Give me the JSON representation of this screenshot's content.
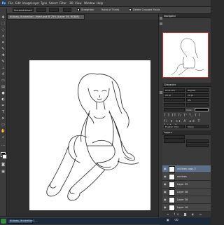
{
  "menubar": {
    "logo": "Ps",
    "items": [
      "File",
      "Edit",
      "Image",
      "Layer",
      "Type",
      "Select",
      "Filter",
      "3D",
      "View",
      "Window",
      "Help"
    ]
  },
  "options": {
    "selection_mode": "Unconstrained",
    "chk1_label": "Straighten",
    "chk2_label": "Ratio of Thirds",
    "chk3_label": "Delete Cropped Pixels"
  },
  "document": {
    "tab_title": "dubsep_illustration1_fixed.psd @ 25% (Layer 39, RGB/8)"
  },
  "panels": {
    "navigator_title": "Navigator",
    "properties_title": "Character",
    "font_name": "Zonbi Pro",
    "font_style": "Regular",
    "size1": "29 pt",
    "size2": "29 pt",
    "tracking": "0%",
    "color_label": "Color:",
    "language": "English: USA",
    "aa": "Sharp",
    "layers_title": "Layers"
  },
  "layers": [
    {
      "name": "outlines copy 2",
      "selected": true
    },
    {
      "name": "outlines",
      "selected": false
    },
    {
      "name": "Layer 39",
      "selected": false
    },
    {
      "name": "Layer 38",
      "selected": false
    },
    {
      "name": "Layer 36",
      "selected": false
    },
    {
      "name": "Layer 16",
      "selected": false
    }
  ],
  "taskbar": {
    "item": "dubsep_illustration1..."
  }
}
